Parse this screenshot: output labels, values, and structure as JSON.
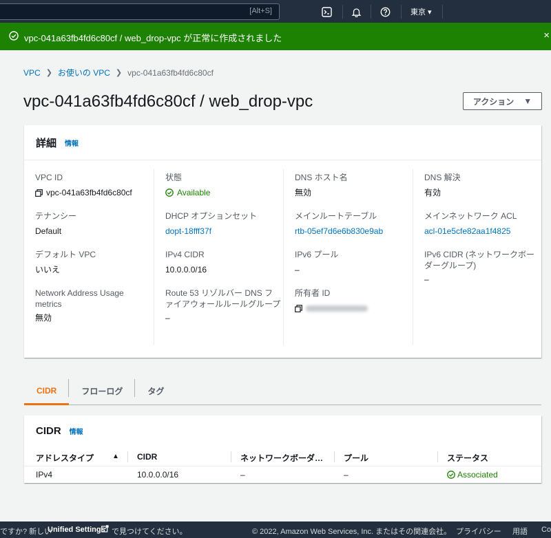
{
  "topnav": {
    "search_hint": "[Alt+S]",
    "icons": [
      "cloudshell-icon",
      "bell-icon",
      "help-icon"
    ],
    "region": "東京 ▾"
  },
  "flash": {
    "message": "vpc-041a63fb4fd6c80cf / web_drop-vpc が正常に作成されました",
    "close": "×"
  },
  "breadcrumb": {
    "items": [
      "VPC",
      "お使いの VPC",
      "vpc-041a63fb4fd6c80cf"
    ]
  },
  "page": {
    "title": "vpc-041a63fb4fd6c80cf / web_drop-vpc",
    "action_label": "アクション",
    "action_caret": "▼"
  },
  "details": {
    "heading": "詳細",
    "info": "情報",
    "fields": {
      "vpc_id": {
        "label": "VPC ID",
        "value": "vpc-041a63fb4fd6c80cf"
      },
      "tenancy": {
        "label": "テナンシー",
        "value": "Default"
      },
      "default_vpc": {
        "label": "デフォルト VPC",
        "value": "いいえ"
      },
      "nau_metrics": {
        "label": "Network Address Usage metrics",
        "value": "無効"
      },
      "state": {
        "label": "状態",
        "value": "Available"
      },
      "dhcp": {
        "label": "DHCP オプションセット",
        "value": "dopt-18fff37f"
      },
      "ipv4_cidr": {
        "label": "IPv4 CIDR",
        "value": "10.0.0.0/16"
      },
      "route53": {
        "label": "Route 53 リゾルバー DNS ファイアウォールルールグループ",
        "value": "–"
      },
      "dns_hostname": {
        "label": "DNS ホスト名",
        "value": "無効"
      },
      "main_rt": {
        "label": "メインルートテーブル",
        "value": "rtb-05ef7d6e6b830e9ab"
      },
      "ipv6_pool": {
        "label": "IPv6 プール",
        "value": "–"
      },
      "owner_id": {
        "label": "所有者 ID",
        "value": ""
      },
      "dns_resolution": {
        "label": "DNS 解決",
        "value": "有効"
      },
      "main_acl": {
        "label": "メインネットワーク ACL",
        "value": "acl-01e5cfe82aa1f4825"
      },
      "ipv6_cidr": {
        "label": "IPv6 CIDR (ネットワークボーダーグループ)",
        "value": "–"
      }
    }
  },
  "tabs": [
    "CIDR",
    "フローログ",
    "タグ"
  ],
  "cidr_table": {
    "heading": "CIDR",
    "info": "情報",
    "columns": [
      "アドレスタイプ",
      "CIDR",
      "ネットワークボーダ…",
      "プール",
      "ステータス"
    ],
    "sort_indicator": "▲",
    "rows": [
      [
        "IPv4",
        "10.0.0.0/16",
        "–",
        "–",
        "Associated"
      ]
    ]
  },
  "footer": {
    "left_prefix": "ですか? 新しい",
    "left_link": "Unified Settings",
    "left_suffix": "で見つけてください。",
    "copyright": "© 2022, Amazon Web Services, Inc. またはその関連会社。",
    "privacy": "プライバシー",
    "terms": "用語",
    "cookie": "Co"
  },
  "colors": {
    "success": "#1d8102",
    "link": "#0073bb",
    "accent": "#ec7211",
    "nav": "#232f3e"
  }
}
